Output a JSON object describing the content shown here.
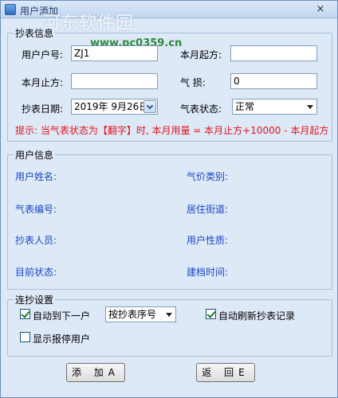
{
  "window": {
    "title": "用户添加",
    "close_glyph": "×",
    "watermark": "河东软件园",
    "watermark_url": "www.pc0359.cn"
  },
  "meter_info": {
    "legend": "抄表信息",
    "user_id_label": "用户户号:",
    "user_id_value": "ZJ1",
    "month_start_label": "本月起方:",
    "month_start_value": "",
    "month_end_label": "本月止方:",
    "month_end_value": "",
    "gas_loss_label": "气    损:",
    "gas_loss_value": "0",
    "read_date_label": "抄表日期:",
    "read_date_value": "2019年 9月26日",
    "meter_state_label": "气表状态:",
    "meter_state_value": "正常",
    "hint": "提示: 当气表状态为【翻字】时, 本月用量 = 本月止方+10000 - 本月起方"
  },
  "user_info": {
    "legend": "用户信息",
    "name_label": "用户姓名:",
    "price_type_label": "气价类别:",
    "meter_no_label": "气表编号:",
    "street_label": "居住街道:",
    "reader_label": "抄表人员:",
    "user_type_label": "用户性质:",
    "status_label": "目前状态:",
    "created_label": "建档时间:"
  },
  "continuous": {
    "legend": "连抄设置",
    "auto_next_label": "自动到下一户",
    "auto_next_checked": true,
    "order_value": "按抄表序号",
    "auto_refresh_label": "自动刷新抄表记录",
    "auto_refresh_checked": true,
    "show_stopped_label": "显示报停用户",
    "show_stopped_checked": false
  },
  "buttons": {
    "add": "添 加A",
    "back": "返 回E"
  }
}
